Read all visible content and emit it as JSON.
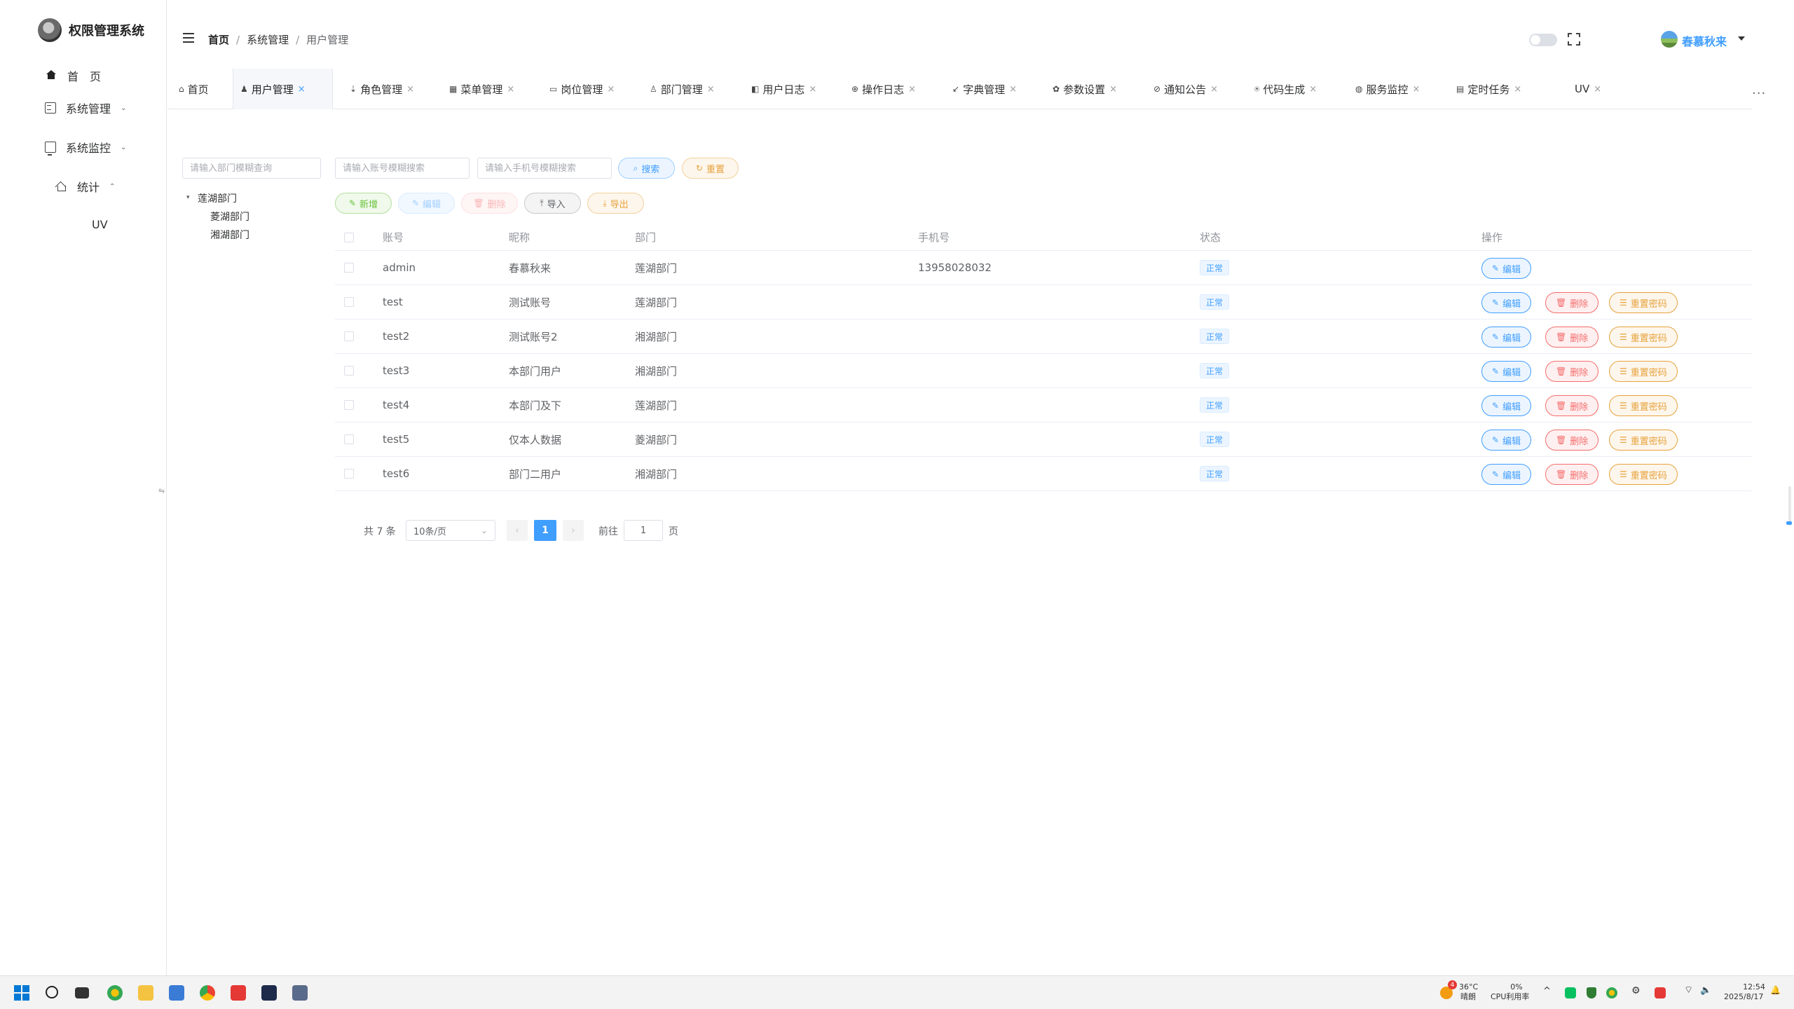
{
  "app": {
    "title": "权限管理系统"
  },
  "sidebar": {
    "items": [
      {
        "label": "首　页"
      },
      {
        "label": "系统管理"
      },
      {
        "label": "系统监控"
      },
      {
        "label": "统计"
      },
      {
        "label": "UV"
      }
    ],
    "collapse_glyph": "⇋"
  },
  "header": {
    "breadcrumb": [
      "首页",
      "系统管理",
      "用户管理"
    ],
    "breadcrumb_sep": "/",
    "user_name": "春慕秋来"
  },
  "tabs": [
    {
      "label": "首页",
      "icon": "⌂"
    },
    {
      "label": "用户管理",
      "icon": "♟"
    },
    {
      "label": "角色管理",
      "icon": "⇣"
    },
    {
      "label": "菜单管理",
      "icon": "▦"
    },
    {
      "label": "岗位管理",
      "icon": "▭"
    },
    {
      "label": "部门管理",
      "icon": "♙"
    },
    {
      "label": "用户日志",
      "icon": "◧"
    },
    {
      "label": "操作日志",
      "icon": "⊕"
    },
    {
      "label": "字典管理",
      "icon": "↙"
    },
    {
      "label": "参数设置",
      "icon": "✿"
    },
    {
      "label": "通知公告",
      "icon": "⊘"
    },
    {
      "label": "代码生成",
      "icon": "⍟"
    },
    {
      "label": "服务监控",
      "icon": "◍"
    },
    {
      "label": "定时任务",
      "icon": "▤"
    },
    {
      "label": "UV",
      "icon": ""
    }
  ],
  "tab_close": "×",
  "tabs_more": "···",
  "dept": {
    "search_placeholder": "请输入部门模糊查询",
    "tree": [
      {
        "label": "莲湖部门",
        "arrow": "▾"
      },
      {
        "label": "菱湖部门"
      },
      {
        "label": "湘湖部门"
      }
    ]
  },
  "filters": {
    "account_placeholder": "请输入账号模糊搜索",
    "phone_placeholder": "请输入手机号模糊搜索",
    "search_label": "搜索",
    "search_icon": "⌕",
    "reset_label": "重置",
    "reset_icon": "↻"
  },
  "toolbar": {
    "add_label": "新增",
    "add_icon": "✎",
    "edit_label": "编辑",
    "edit_icon": "✎",
    "delete_label": "删除",
    "delete_icon": "🗑",
    "import_label": "导入",
    "import_icon": "⤒",
    "export_label": "导出",
    "export_icon": "⤓"
  },
  "table": {
    "headers": {
      "account": "账号",
      "nickname": "昵称",
      "dept": "部门",
      "phone": "手机号",
      "status": "状态",
      "ops": "操作"
    },
    "rows": [
      {
        "account": "admin",
        "nickname": "春慕秋来",
        "dept": "莲湖部门",
        "phone": "13958028032",
        "status": "正常"
      },
      {
        "account": "test",
        "nickname": "测试账号",
        "dept": "莲湖部门",
        "phone": "",
        "status": "正常"
      },
      {
        "account": "test2",
        "nickname": "测试账号2",
        "dept": "湘湖部门",
        "phone": "",
        "status": "正常"
      },
      {
        "account": "test3",
        "nickname": "本部门用户",
        "dept": "湘湖部门",
        "phone": "",
        "status": "正常"
      },
      {
        "account": "test4",
        "nickname": "本部门及下",
        "dept": "莲湖部门",
        "phone": "",
        "status": "正常"
      },
      {
        "account": "test5",
        "nickname": "仅本人数据",
        "dept": "菱湖部门",
        "phone": "",
        "status": "正常"
      },
      {
        "account": "test6",
        "nickname": "部门二用户",
        "dept": "湘湖部门",
        "phone": "",
        "status": "正常"
      }
    ],
    "op_edit": "编辑",
    "op_delete": "删除",
    "op_reset_pwd": "重置密码",
    "op_edit_icon": "✎",
    "op_delete_icon": "🗑",
    "op_reset_icon": "☰"
  },
  "pagination": {
    "total": "共 7 条",
    "page_size": "10条/页",
    "page_size_caret": "⌄",
    "prev": "‹",
    "current_page": "1",
    "next": "›",
    "goto_label": "前往",
    "goto_value": "1",
    "page_label": "页"
  },
  "taskbar": {
    "weather_badge": "4",
    "weather_temp": "36°C",
    "weather_desc": "晴朗",
    "cpu_value": "0%",
    "cpu_label": "CPU利用率",
    "tray_chevron": "^",
    "time": "12:54",
    "date": "2025/8/17",
    "tray_wifi": "⌔",
    "tray_volume": "🔈",
    "tray_bell": "🔔",
    "tray_settings": "⚙"
  }
}
